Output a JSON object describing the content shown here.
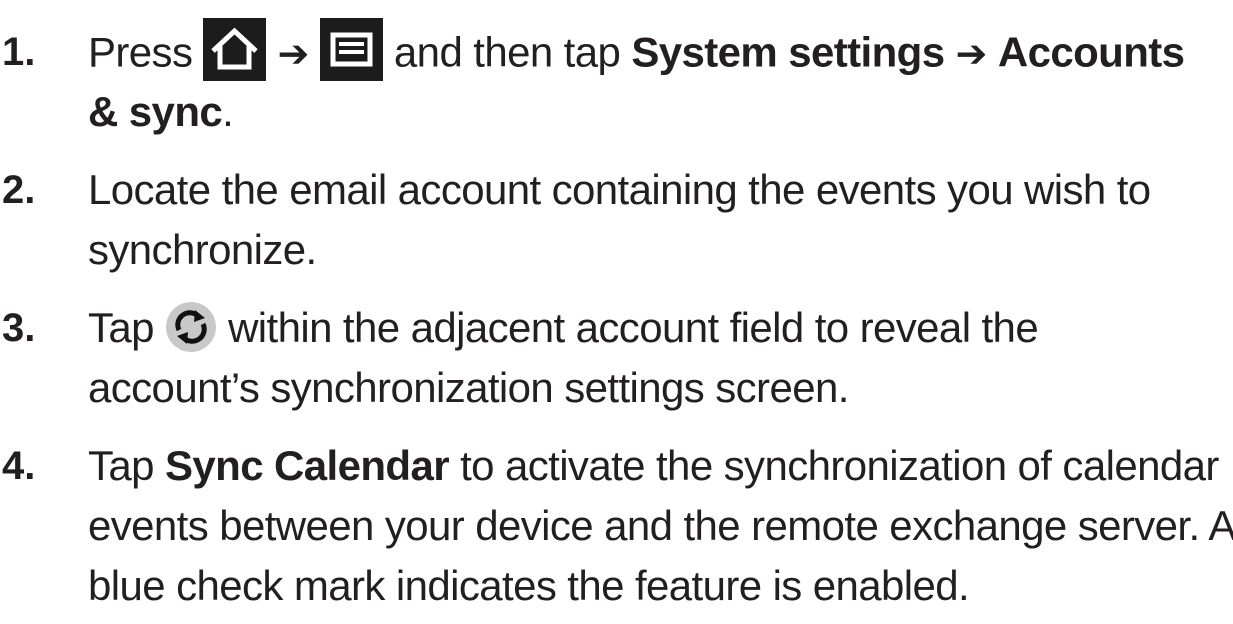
{
  "steps": [
    {
      "number": "1.",
      "line1": {
        "press": "Press",
        "arrow1": "➔",
        "mid": "and then tap",
        "system_settings": "System settings",
        "arrow2": "➔",
        "accounts": "Accounts"
      },
      "line2": {
        "accounts_cont": "& sync",
        "period": "."
      },
      "icons": [
        "home-icon",
        "menu-icon"
      ]
    },
    {
      "number": "2.",
      "line1": "Locate the email account containing the events you wish to",
      "line2": "synchronize."
    },
    {
      "number": "3.",
      "line1": {
        "tap": "Tap",
        "rest": "within the adjacent account field to reveal the"
      },
      "line2": "account’s synchronization settings screen.",
      "icons": [
        "sync-icon"
      ]
    },
    {
      "number": "4.",
      "line1": {
        "tap": "Tap",
        "sync_calendar": "Sync Calendar",
        "rest": "to activate the synchronization of calendar"
      },
      "line2": "events between your device and the remote exchange server. A",
      "line3": "blue check mark indicates the feature is enabled."
    }
  ],
  "colors": {
    "text": "#231f20",
    "icon_bg": "#1c1c1c",
    "sync_circle": "#c8c8c8"
  }
}
